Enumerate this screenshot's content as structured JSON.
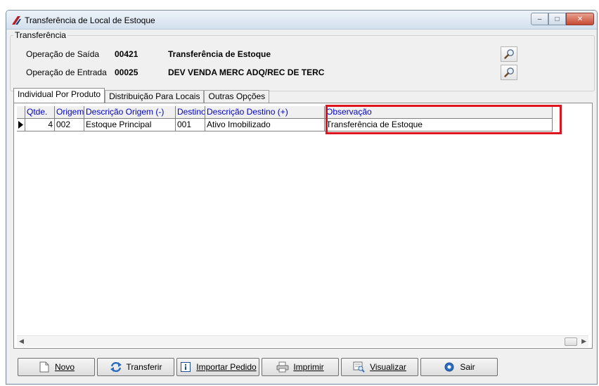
{
  "window": {
    "title": "Transferência de Local de Estoque",
    "controls": {
      "minimize": "–",
      "maximize": "□",
      "close": "✕"
    }
  },
  "group": {
    "label": "Transferência",
    "saida": {
      "label": "Operação de Saída",
      "code": "00421",
      "description": "Transferência de Estoque"
    },
    "entrada": {
      "label": "Operação de Entrada",
      "code": "00025",
      "description": "DEV VENDA MERC ADQ/REC DE TERC"
    }
  },
  "tabs": [
    {
      "label": "Individual Por Produto",
      "active": true
    },
    {
      "label": "Distribuição Para Locais",
      "active": false
    },
    {
      "label": "Outras Opções",
      "active": false
    }
  ],
  "grid": {
    "columns": {
      "qtde": "Qtde.",
      "origem": "Origem",
      "descricao_origem": "Descrição Origem (-)",
      "destino": "Destino",
      "descricao_destino": "Descrição Destino (+)",
      "observacao": "Observação"
    },
    "rows": [
      {
        "qtde": "4",
        "origem": "002",
        "descricao_origem": "Estoque Principal",
        "destino": "001",
        "descricao_destino": "Ativo Imobilizado",
        "observacao": "Transferência de Estoque"
      }
    ]
  },
  "buttons": {
    "novo": "Novo",
    "transferir": "Transferir",
    "importar": "Importar Pedido",
    "imprimir": "Imprimir",
    "visualizar": "Visualizar",
    "sair": "Sair"
  },
  "colors": {
    "highlight": "#e0141e",
    "header_text": "#0000cc"
  }
}
